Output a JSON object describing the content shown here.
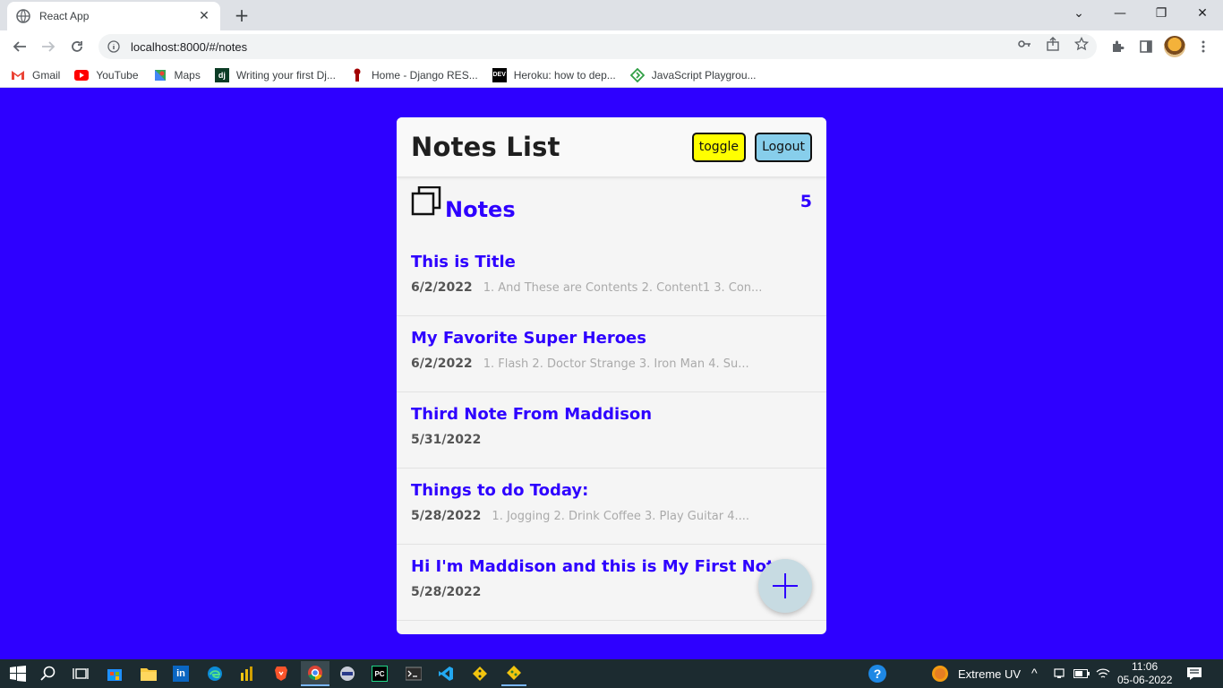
{
  "browser": {
    "tab_title": "React App",
    "url": "localhost:8000/#/notes",
    "bookmarks": [
      {
        "label": "Gmail",
        "icon": "gmail-icon"
      },
      {
        "label": "YouTube",
        "icon": "youtube-icon"
      },
      {
        "label": "Maps",
        "icon": "maps-icon"
      },
      {
        "label": "Writing your first Dj...",
        "icon": "django-icon"
      },
      {
        "label": "Home - Django RES...",
        "icon": "drf-icon"
      },
      {
        "label": "Heroku: how to dep...",
        "icon": "dev-icon"
      },
      {
        "label": "JavaScript Playgrou...",
        "icon": "playground-icon"
      }
    ]
  },
  "app": {
    "title": "Notes List",
    "toggle_label": "toggle",
    "logout_label": "Logout",
    "notes_heading": "Notes",
    "notes_count": "5",
    "notes": [
      {
        "title": "This is Title",
        "date": "6/2/2022",
        "preview": "1. And These are Contents 2. Content1 3. Con..."
      },
      {
        "title": "My Favorite Super Heroes",
        "date": "6/2/2022",
        "preview": "1. Flash 2. Doctor Strange 3. Iron Man 4. Su..."
      },
      {
        "title": "Third Note From Maddison",
        "date": "5/31/2022",
        "preview": ""
      },
      {
        "title": "Things to do Today:",
        "date": "5/28/2022",
        "preview": "1. Jogging 2. Drink Coffee 3. Play Guitar 4...."
      },
      {
        "title": "Hi I'm Maddison and this is My First Note",
        "date": "5/28/2022",
        "preview": ""
      }
    ],
    "colors": {
      "background": "#2e00ff",
      "accent": "#2e00ff",
      "toggle_bg": "#ffff00",
      "logout_bg": "#87ceeb",
      "fab_bg": "#c7dbe2"
    }
  },
  "taskbar": {
    "weather": "Extreme UV",
    "time": "11:06",
    "date": "05-06-2022"
  }
}
